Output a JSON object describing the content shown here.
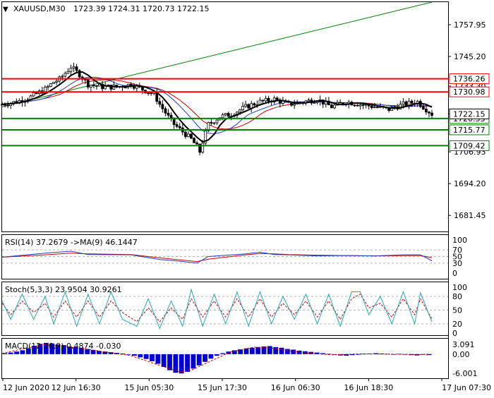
{
  "header": {
    "symbol": "XAUUSD,M30",
    "ohlc": "1723.39 1724.31 1720.73 1722.15"
  },
  "chart_data": {
    "type": "candlestick",
    "symbol": "XAUUSD",
    "timeframe": "M30",
    "price_axis": {
      "ylim": [
        1675.0,
        1767.0
      ],
      "ticks": [
        "1757.95",
        "1745.20",
        "1733.30",
        "1722.15",
        "1706.93",
        "1694.20",
        "1681.45"
      ]
    },
    "x_ticks": [
      "12 Jun 2020",
      "12 Jun 16:30",
      "15 Jun 05:30",
      "15 Jun 17:30",
      "16 Jun 06:30",
      "16 Jun 18:30",
      "17 Jun 07:30"
    ],
    "current_price": "1722.15",
    "levels": [
      {
        "label": "1736.26",
        "value": 1736.26,
        "color": "#ff0000"
      },
      {
        "label": "1730.98",
        "value": 1730.98,
        "color": "#ff0000"
      },
      {
        "label": "1720.33",
        "value": 1720.33,
        "color": "#008000"
      },
      {
        "label": "1715.77",
        "value": 1715.77,
        "color": "#008000"
      },
      {
        "label": "1709.42",
        "value": 1709.42,
        "color": "#008000"
      }
    ],
    "trendline": {
      "from": [
        0,
        1725.0
      ],
      "to": [
        150,
        1767.0
      ],
      "color": "#008000"
    },
    "close_path": [
      [
        0,
        1726
      ],
      [
        5,
        1727
      ],
      [
        10,
        1729
      ],
      [
        15,
        1732
      ],
      [
        18,
        1735
      ],
      [
        20,
        1736
      ],
      [
        24,
        1741
      ],
      [
        27,
        1738
      ],
      [
        30,
        1734
      ],
      [
        35,
        1733
      ],
      [
        40,
        1733
      ],
      [
        45,
        1734
      ],
      [
        49,
        1732
      ],
      [
        53,
        1730
      ],
      [
        55,
        1726
      ],
      [
        58,
        1721
      ],
      [
        60,
        1718
      ],
      [
        62,
        1716
      ],
      [
        64,
        1714
      ],
      [
        66,
        1712
      ],
      [
        68,
        1709
      ],
      [
        69,
        1707
      ],
      [
        70,
        1711
      ],
      [
        72,
        1718
      ],
      [
        76,
        1721
      ],
      [
        80,
        1722
      ],
      [
        85,
        1725
      ],
      [
        90,
        1727
      ],
      [
        95,
        1728
      ],
      [
        100,
        1726
      ],
      [
        105,
        1727
      ],
      [
        110,
        1728
      ],
      [
        115,
        1725
      ],
      [
        120,
        1727
      ],
      [
        125,
        1726
      ],
      [
        130,
        1725
      ],
      [
        135,
        1724
      ],
      [
        140,
        1726
      ],
      [
        145,
        1727
      ],
      [
        148,
        1724
      ],
      [
        150,
        1722.15
      ]
    ],
    "rsi": {
      "label": "RSI(14) 37.2679 ->MA(9) 46.1447",
      "ylim": [
        0,
        100
      ],
      "ticks": [
        "100",
        "70",
        "50",
        "30",
        "0"
      ],
      "levels": [
        70,
        50,
        30
      ],
      "rsi_path": [
        [
          0,
          48
        ],
        [
          15,
          60
        ],
        [
          24,
          66
        ],
        [
          30,
          56
        ],
        [
          45,
          55
        ],
        [
          55,
          41
        ],
        [
          62,
          36
        ],
        [
          68,
          30
        ],
        [
          72,
          50
        ],
        [
          85,
          58
        ],
        [
          90,
          63
        ],
        [
          95,
          56
        ],
        [
          100,
          55
        ],
        [
          110,
          52
        ],
        [
          120,
          53
        ],
        [
          130,
          52
        ],
        [
          140,
          55
        ],
        [
          146,
          55
        ],
        [
          150,
          37.27
        ]
      ],
      "ma_path": [
        [
          0,
          48
        ],
        [
          15,
          55
        ],
        [
          24,
          60
        ],
        [
          30,
          58
        ],
        [
          45,
          56
        ],
        [
          55,
          46
        ],
        [
          62,
          40
        ],
        [
          68,
          35
        ],
        [
          72,
          42
        ],
        [
          85,
          55
        ],
        [
          90,
          59
        ],
        [
          95,
          58
        ],
        [
          100,
          56
        ],
        [
          110,
          54
        ],
        [
          120,
          53
        ],
        [
          130,
          52
        ],
        [
          140,
          53
        ],
        [
          146,
          53
        ],
        [
          150,
          46.14
        ]
      ]
    },
    "stoch": {
      "label": "Stoch(5,3,3) 23.9504 30.9261",
      "ylim": [
        0,
        100
      ],
      "ticks": [
        "100",
        "80",
        "50",
        "20",
        "0"
      ],
      "levels": [
        80,
        50,
        20
      ],
      "k_path": [
        [
          0,
          70
        ],
        [
          3,
          30
        ],
        [
          7,
          85
        ],
        [
          11,
          30
        ],
        [
          15,
          80
        ],
        [
          18,
          20
        ],
        [
          22,
          90
        ],
        [
          26,
          15
        ],
        [
          30,
          85
        ],
        [
          34,
          20
        ],
        [
          38,
          90
        ],
        [
          42,
          30
        ],
        [
          47,
          15
        ],
        [
          51,
          75
        ],
        [
          55,
          10
        ],
        [
          59,
          70
        ],
        [
          63,
          15
        ],
        [
          66,
          95
        ],
        [
          70,
          15
        ],
        [
          74,
          85
        ],
        [
          78,
          20
        ],
        [
          82,
          90
        ],
        [
          86,
          15
        ],
        [
          90,
          90
        ],
        [
          94,
          20
        ],
        [
          98,
          80
        ],
        [
          102,
          30
        ],
        [
          106,
          85
        ],
        [
          110,
          20
        ],
        [
          114,
          85
        ],
        [
          118,
          15
        ],
        [
          122,
          90
        ],
        [
          125,
          90
        ],
        [
          128,
          40
        ],
        [
          132,
          80
        ],
        [
          136,
          20
        ],
        [
          140,
          90
        ],
        [
          144,
          20
        ],
        [
          146,
          88
        ],
        [
          150,
          23.95
        ]
      ],
      "d_path": [
        [
          0,
          65
        ],
        [
          3,
          40
        ],
        [
          7,
          70
        ],
        [
          11,
          45
        ],
        [
          15,
          65
        ],
        [
          18,
          35
        ],
        [
          22,
          70
        ],
        [
          26,
          35
        ],
        [
          30,
          70
        ],
        [
          34,
          35
        ],
        [
          38,
          70
        ],
        [
          42,
          45
        ],
        [
          47,
          25
        ],
        [
          51,
          55
        ],
        [
          55,
          25
        ],
        [
          59,
          55
        ],
        [
          63,
          30
        ],
        [
          66,
          75
        ],
        [
          70,
          35
        ],
        [
          74,
          70
        ],
        [
          78,
          35
        ],
        [
          82,
          75
        ],
        [
          86,
          35
        ],
        [
          90,
          75
        ],
        [
          94,
          35
        ],
        [
          98,
          65
        ],
        [
          102,
          40
        ],
        [
          106,
          70
        ],
        [
          110,
          35
        ],
        [
          114,
          70
        ],
        [
          118,
          30
        ],
        [
          122,
          75
        ],
        [
          125,
          85
        ],
        [
          128,
          55
        ],
        [
          132,
          65
        ],
        [
          136,
          35
        ],
        [
          140,
          75
        ],
        [
          144,
          40
        ],
        [
          146,
          75
        ],
        [
          150,
          30.93
        ]
      ]
    },
    "macd": {
      "label": "MACD(12,26,9) 0.4874 -0.030",
      "ticks": [
        "3.091",
        "0.00",
        "-6.001"
      ],
      "ylim": [
        -7.5,
        4.8
      ],
      "histogram": [
        0.3,
        0.5,
        0.8,
        1.2,
        1.8,
        2.6,
        3.2,
        3.5,
        3.3,
        3.0,
        2.8,
        2.4,
        2.2,
        2.0,
        1.6,
        1.3,
        1.0,
        0.8,
        0.6,
        0.4,
        0.2,
        0.0,
        -0.5,
        -1.0,
        -1.5,
        -2.2,
        -3.0,
        -4.0,
        -5.0,
        -5.8,
        -6.0,
        -5.5,
        -4.5,
        -3.5,
        -2.4,
        -1.4,
        -0.5,
        0.3,
        0.8,
        1.2,
        1.5,
        1.8,
        2.0,
        2.2,
        2.4,
        2.5,
        2.2,
        2.0,
        1.6,
        1.4,
        1.1,
        0.9,
        0.7,
        0.5,
        0.3,
        0.1,
        -0.2,
        -0.4,
        -0.5,
        -0.3,
        -0.1,
        0.1,
        0.2,
        0.3,
        0.2,
        0.1,
        0.0,
        0.1,
        0.0,
        -0.3,
        -0.4,
        -0.2,
        -0.3
      ],
      "signal_path": [
        [
          0,
          0.2
        ],
        [
          8,
          1.8
        ],
        [
          15,
          3.0
        ],
        [
          20,
          2.5
        ],
        [
          30,
          1.5
        ],
        [
          45,
          -0.5
        ],
        [
          55,
          -3.5
        ],
        [
          62,
          -5.5
        ],
        [
          66,
          -5.0
        ],
        [
          72,
          -2.5
        ],
        [
          80,
          0.8
        ],
        [
          88,
          2.2
        ],
        [
          95,
          1.8
        ],
        [
          105,
          0.4
        ],
        [
          115,
          -0.2
        ],
        [
          125,
          0.1
        ],
        [
          135,
          0.0
        ],
        [
          145,
          -0.1
        ],
        [
          150,
          -0.03
        ]
      ]
    }
  }
}
